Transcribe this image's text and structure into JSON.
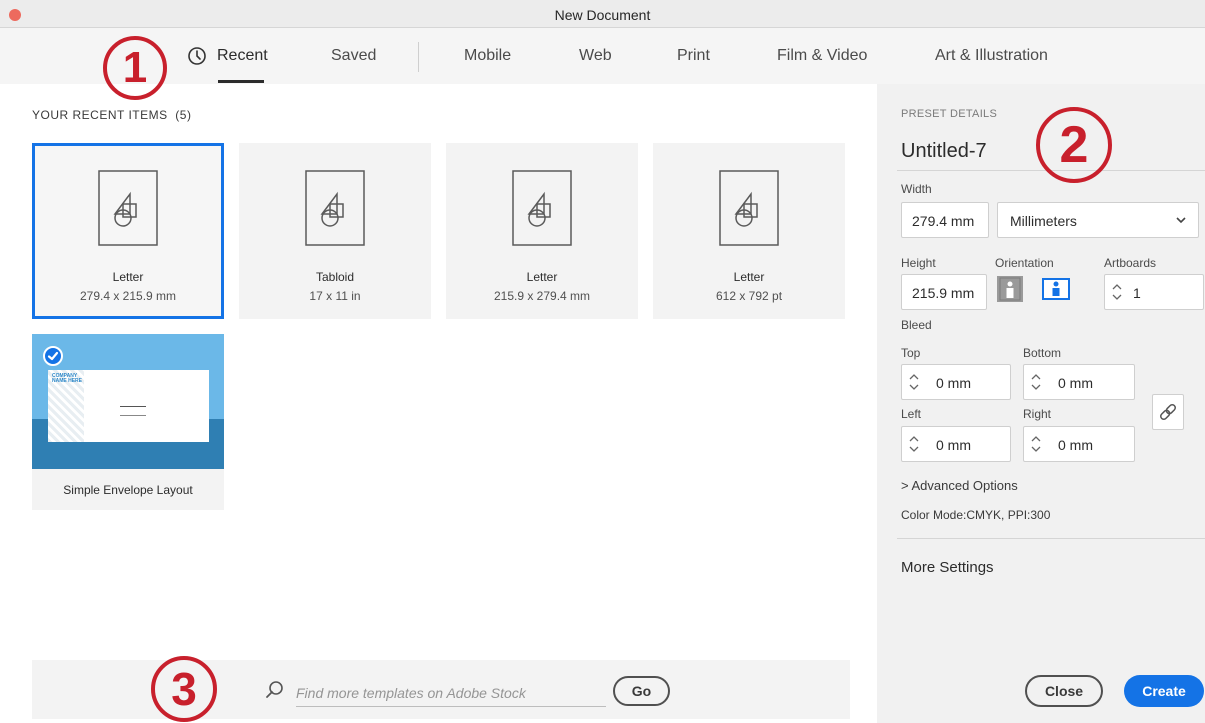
{
  "window": {
    "title": "New Document"
  },
  "tabs": [
    {
      "label": "Recent",
      "active": true
    },
    {
      "label": "Saved"
    },
    {
      "label": "Mobile"
    },
    {
      "label": "Web"
    },
    {
      "label": "Print"
    },
    {
      "label": "Film & Video"
    },
    {
      "label": "Art & Illustration"
    }
  ],
  "callouts": [
    "1",
    "2",
    "3"
  ],
  "recent": {
    "heading": "YOUR RECENT ITEMS",
    "count": "(5)",
    "items": [
      {
        "name": "Letter",
        "size": "279.4 x 215.9 mm",
        "selected": true
      },
      {
        "name": "Tabloid",
        "size": "17 x 11 in"
      },
      {
        "name": "Letter",
        "size": "215.9 x 279.4 mm"
      },
      {
        "name": "Letter",
        "size": "612 x 792 pt"
      }
    ],
    "template": {
      "name": "Simple Envelope Layout",
      "thumb_text": "COMPANY NAME HERE",
      "checked": true
    }
  },
  "search": {
    "placeholder": "Find more templates on Adobe Stock",
    "go_label": "Go"
  },
  "preset": {
    "heading": "PRESET DETAILS",
    "name": "Untitled-7",
    "width_label": "Width",
    "width_value": "279.4 mm",
    "units": "Millimeters",
    "height_label": "Height",
    "height_value": "215.9 mm",
    "orientation_label": "Orientation",
    "orientation_selected": "landscape",
    "artboards_label": "Artboards",
    "artboards_value": "1",
    "bleed_label": "Bleed",
    "top_label": "Top",
    "top_value": "0 mm",
    "bottom_label": "Bottom",
    "bottom_value": "0 mm",
    "left_label": "Left",
    "left_value": "0 mm",
    "right_label": "Right",
    "right_value": "0 mm",
    "advanced_label": "Advanced Options",
    "color_mode": "Color Mode:CMYK, PPI:300",
    "more_settings": "More Settings",
    "close_label": "Close",
    "create_label": "Create"
  },
  "colors": {
    "accent": "#1473e6",
    "callout": "#c8202c",
    "panel_bg": "#f1f1f1"
  }
}
